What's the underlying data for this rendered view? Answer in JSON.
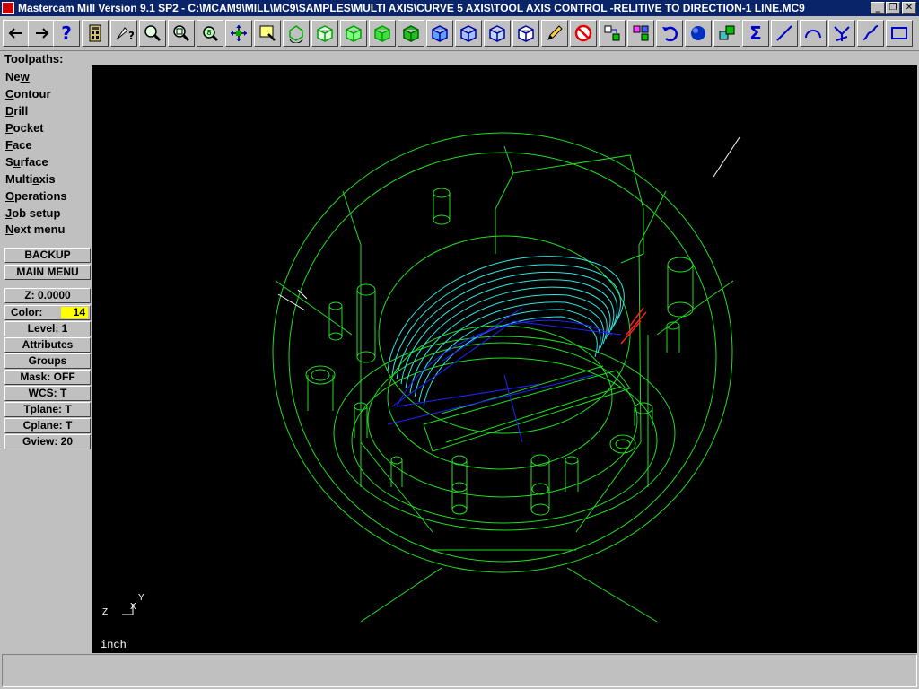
{
  "window": {
    "title": "Mastercam Mill Version 9.1 SP2 - C:\\MCAM9\\MILL\\MC9\\SAMPLES\\MULTI AXIS\\CURVE 5 AXIS\\TOOL AXIS CONTROL -RELITIVE TO DIRECTION-1 LINE.MC9",
    "minimize": "_",
    "restore": "❐",
    "close": "✕"
  },
  "toolbar": {
    "icons": [
      "back-arrow-icon",
      "forward-arrow-icon",
      "help-icon",
      "calculator-icon",
      "analyze-icon",
      "zoom-icon",
      "unzoom-icon",
      "zoom-target-icon",
      "pan-icon",
      "screen-fit-icon",
      "rotate-icon",
      "cube-top-icon",
      "cube-front-icon",
      "cube-side-icon",
      "cube-iso-icon",
      "cplane-top-icon",
      "cplane-front-icon",
      "cplane-side-icon",
      "cplane-iso-icon",
      "pencil-icon",
      "no-sign-icon",
      "transform-icon",
      "color-change-icon",
      "undo-icon",
      "sphere-icon",
      "layers-icon",
      "sigma-icon",
      "line-icon",
      "arc-icon",
      "trim-icon",
      "spline-icon",
      "rectangle-icon"
    ]
  },
  "menu": {
    "title": "Toolpaths:",
    "items": [
      {
        "pre": "Ne",
        "u": "w",
        "post": ""
      },
      {
        "pre": "",
        "u": "C",
        "post": "ontour"
      },
      {
        "pre": "",
        "u": "D",
        "post": "rill"
      },
      {
        "pre": "",
        "u": "P",
        "post": "ocket"
      },
      {
        "pre": "",
        "u": "F",
        "post": "ace"
      },
      {
        "pre": "S",
        "u": "u",
        "post": "rface"
      },
      {
        "pre": "Multi",
        "u": "a",
        "post": "xis"
      },
      {
        "pre": "",
        "u": "O",
        "post": "perations"
      },
      {
        "pre": "",
        "u": "J",
        "post": "ob setup"
      },
      {
        "pre": "",
        "u": "N",
        "post": "ext menu"
      }
    ]
  },
  "buttons": {
    "backup": "BACKUP",
    "main_menu": "MAIN MENU"
  },
  "status": {
    "z": "Z:  0.0000",
    "color_label": "Color:",
    "color_value": "14",
    "level": "Level:  1",
    "attributes": "Attributes",
    "groups": "Groups",
    "mask": "Mask:  OFF",
    "wcs": "WCS:  T",
    "tplane": "Tplane:  T",
    "cplane": "Cplane:  T",
    "gview": "Gview:  20"
  },
  "viewport": {
    "units": "inch",
    "axis_x": "X",
    "axis_y": "Y",
    "axis_z": "Z"
  },
  "colors": {
    "geometry": "#22dd22",
    "toolpath": "#33e5e5",
    "tool_axis": "#2222ff",
    "highlight": "#ff2020",
    "background": "#000000",
    "title_bar": "#0a246a",
    "color_swatch": "#ffff00"
  },
  "prompt": {
    "text": ""
  }
}
